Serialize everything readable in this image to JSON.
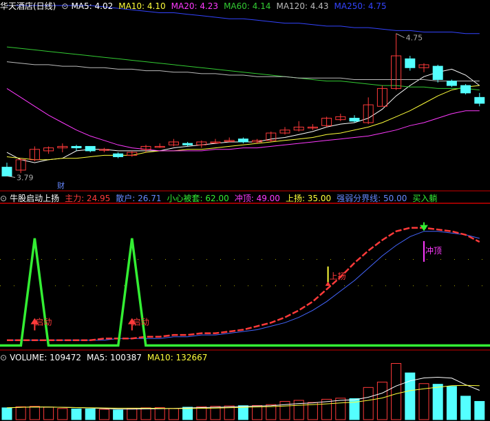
{
  "colors": {
    "bg": "#000000",
    "up": "#ff3a3a",
    "down": "#54ffff",
    "white": "#ffffff",
    "yellow": "#ffff3a",
    "magenta": "#ff3aff",
    "green": "#33cc33",
    "blue": "#2222cc",
    "gray": "#aaaaaa",
    "separator": "#cc0000",
    "orange": "#ff8800"
  },
  "price_panel": {
    "stock_name": "华天酒店(日线)",
    "indicators": [
      {
        "label": "MA5: 4.02",
        "color": "#ffffff"
      },
      {
        "label": "MA10: 4.10",
        "color": "#ffff3a"
      },
      {
        "label": "MA20: 4.23",
        "color": "#ff3aff"
      },
      {
        "label": "MA60: 4.14",
        "color": "#33cc33"
      },
      {
        "label": "MA120: 4.43",
        "color": "#bbbbbb"
      },
      {
        "label": "MA250: 4.75",
        "color": "#3344ff"
      }
    ],
    "high_label": "4.75",
    "low_label": "3.79",
    "caitag": "财"
  },
  "indicator_panel": {
    "title": "牛股启动上扬",
    "items": [
      {
        "label": "主力: 24.95",
        "color": "#ff3a3a"
      },
      {
        "label": "散户: 26.71",
        "color": "#6688ff"
      },
      {
        "label": "小心被套: 62.00",
        "color": "#33ee33"
      },
      {
        "label": "冲顶: 49.00",
        "color": "#ff3aff"
      },
      {
        "label": "上扬: 35.00",
        "color": "#ffff3a"
      },
      {
        "label": "强弱分界线: 50.00",
        "color": "#6688ff"
      },
      {
        "label": "买入躺",
        "color": "#33ee33"
      }
    ],
    "marks": {
      "start": "启动",
      "rise": "上扬",
      "top": "冲顶"
    }
  },
  "volume_panel": {
    "title": "VOLUME: 109472",
    "ma5": "MA5: 100387",
    "ma10": "MA10: 132667"
  },
  "chart_data": {
    "type": "candlestick",
    "candles": [
      {
        "o": 3.85,
        "c": 3.79,
        "h": 3.88,
        "l": 3.79
      },
      {
        "o": 3.83,
        "c": 3.9,
        "h": 3.91,
        "l": 3.81
      },
      {
        "o": 3.9,
        "c": 3.97,
        "h": 3.99,
        "l": 3.89
      },
      {
        "o": 3.96,
        "c": 3.98,
        "h": 3.99,
        "l": 3.94
      },
      {
        "o": 3.98,
        "c": 3.99,
        "h": 4.01,
        "l": 3.95
      },
      {
        "o": 3.99,
        "c": 3.98,
        "h": 4.0,
        "l": 3.96
      },
      {
        "o": 3.99,
        "c": 3.96,
        "h": 3.99,
        "l": 3.95
      },
      {
        "o": 3.97,
        "c": 3.97,
        "h": 3.98,
        "l": 3.95
      },
      {
        "o": 3.94,
        "c": 3.92,
        "h": 3.95,
        "l": 3.91
      },
      {
        "o": 3.93,
        "c": 3.95,
        "h": 3.96,
        "l": 3.92
      },
      {
        "o": 3.97,
        "c": 3.99,
        "h": 4.0,
        "l": 3.95
      },
      {
        "o": 3.99,
        "c": 3.99,
        "h": 4.01,
        "l": 3.98
      },
      {
        "o": 4.0,
        "c": 4.02,
        "h": 4.04,
        "l": 3.99
      },
      {
        "o": 4.01,
        "c": 4.0,
        "h": 4.02,
        "l": 3.99
      },
      {
        "o": 4.0,
        "c": 4.02,
        "h": 4.03,
        "l": 3.98
      },
      {
        "o": 4.02,
        "c": 4.02,
        "h": 4.04,
        "l": 4.01
      },
      {
        "o": 4.03,
        "c": 4.03,
        "h": 4.05,
        "l": 4.02
      },
      {
        "o": 4.04,
        "c": 4.02,
        "h": 4.05,
        "l": 4.01
      },
      {
        "o": 4.02,
        "c": 4.03,
        "h": 4.04,
        "l": 4.01
      },
      {
        "o": 4.03,
        "c": 4.08,
        "h": 4.09,
        "l": 4.02
      },
      {
        "o": 4.08,
        "c": 4.1,
        "h": 4.12,
        "l": 4.07
      },
      {
        "o": 4.1,
        "c": 4.12,
        "h": 4.16,
        "l": 4.09
      },
      {
        "o": 4.12,
        "c": 4.12,
        "h": 4.14,
        "l": 4.1
      },
      {
        "o": 4.13,
        "c": 4.18,
        "h": 4.19,
        "l": 4.12
      },
      {
        "o": 4.17,
        "c": 4.19,
        "h": 4.21,
        "l": 4.16
      },
      {
        "o": 4.18,
        "c": 4.16,
        "h": 4.2,
        "l": 4.15
      },
      {
        "o": 4.15,
        "c": 4.27,
        "h": 4.32,
        "l": 4.14
      },
      {
        "o": 4.26,
        "c": 4.38,
        "h": 4.4,
        "l": 4.26
      },
      {
        "o": 4.38,
        "c": 4.6,
        "h": 4.75,
        "l": 4.37
      },
      {
        "o": 4.58,
        "c": 4.52,
        "h": 4.6,
        "l": 4.5
      },
      {
        "o": 4.52,
        "c": 4.54,
        "h": 4.55,
        "l": 4.49
      },
      {
        "o": 4.53,
        "c": 4.44,
        "h": 4.54,
        "l": 4.42
      },
      {
        "o": 4.43,
        "c": 4.4,
        "h": 4.44,
        "l": 4.39
      },
      {
        "o": 4.4,
        "c": 4.35,
        "h": 4.41,
        "l": 4.34
      },
      {
        "o": 4.32,
        "c": 4.28,
        "h": 4.35,
        "l": 4.26
      }
    ],
    "volumes": [
      55000,
      60000,
      62000,
      58000,
      52000,
      50000,
      50000,
      48000,
      45000,
      52000,
      55000,
      56000,
      52000,
      58000,
      60000,
      62000,
      64000,
      65000,
      66000,
      70000,
      85000,
      90000,
      80000,
      95000,
      100000,
      98000,
      150000,
      175000,
      262000,
      218000,
      168000,
      165000,
      155000,
      109472,
      85000
    ],
    "ma_lines": {
      "MA5": {
        "color": "#ffffff",
        "values": [
          3.95,
          3.9,
          3.88,
          3.9,
          3.91,
          3.96,
          3.97,
          3.97,
          3.96,
          3.96,
          3.96,
          3.96,
          3.98,
          3.99,
          4.0,
          4.01,
          4.02,
          4.02,
          4.02,
          4.04,
          4.05,
          4.07,
          4.09,
          4.12,
          4.14,
          4.15,
          4.18,
          4.24,
          4.33,
          4.4,
          4.46,
          4.49,
          4.51,
          4.47,
          4.4
        ]
      },
      "MA10": {
        "color": "#ffff3a",
        "values": [
          3.92,
          3.91,
          3.9,
          3.9,
          3.91,
          3.91,
          3.92,
          3.93,
          3.93,
          3.93,
          3.95,
          3.96,
          3.96,
          3.97,
          3.97,
          3.98,
          3.99,
          4.0,
          4.01,
          4.02,
          4.03,
          4.04,
          4.05,
          4.07,
          4.08,
          4.1,
          4.12,
          4.15,
          4.19,
          4.23,
          4.28,
          4.33,
          4.37,
          4.39,
          4.4
        ]
      },
      "MA20": {
        "color": "#ff3aff",
        "values": [
          4.38,
          4.32,
          4.26,
          4.2,
          4.15,
          4.1,
          4.06,
          4.03,
          4.0,
          3.98,
          3.97,
          3.96,
          3.96,
          3.96,
          3.96,
          3.97,
          3.97,
          3.98,
          3.98,
          3.99,
          4.0,
          4.01,
          4.02,
          4.03,
          4.04,
          4.05,
          4.06,
          4.08,
          4.1,
          4.13,
          4.15,
          4.18,
          4.21,
          4.23,
          4.23
        ]
      },
      "MA60": {
        "color": "#33cc33",
        "values": [
          4.66,
          4.65,
          4.64,
          4.63,
          4.62,
          4.61,
          4.6,
          4.59,
          4.58,
          4.57,
          4.56,
          4.55,
          4.54,
          4.53,
          4.52,
          4.51,
          4.5,
          4.49,
          4.48,
          4.47,
          4.46,
          4.45,
          4.44,
          4.43,
          4.43,
          4.42,
          4.41,
          4.4,
          4.4,
          4.39,
          4.39,
          4.38,
          4.38,
          4.38,
          4.37
        ]
      },
      "MA120": {
        "color": "#bbbbbb",
        "values": [
          4.56,
          4.55,
          4.54,
          4.54,
          4.53,
          4.53,
          4.52,
          4.52,
          4.51,
          4.51,
          4.5,
          4.5,
          4.49,
          4.49,
          4.48,
          4.48,
          4.47,
          4.47,
          4.46,
          4.46,
          4.46,
          4.45,
          4.45,
          4.45,
          4.45,
          4.44,
          4.44,
          4.44,
          4.44,
          4.44,
          4.44,
          4.43,
          4.43,
          4.43,
          4.43
        ]
      },
      "MA250": {
        "color": "#3344ff",
        "values": [
          5.0,
          4.99,
          4.98,
          4.97,
          4.96,
          4.95,
          4.94,
          4.93,
          4.92,
          4.91,
          4.9,
          4.89,
          4.89,
          4.88,
          4.87,
          4.86,
          4.85,
          4.85,
          4.84,
          4.83,
          4.82,
          4.82,
          4.81,
          4.8,
          4.8,
          4.79,
          4.79,
          4.78,
          4.77,
          4.77,
          4.76,
          4.76,
          4.76,
          4.75,
          4.75
        ]
      }
    },
    "main_force": [
      4,
      4,
      4,
      4,
      4,
      4,
      4,
      5,
      5,
      5,
      6,
      6,
      7,
      7,
      8,
      8,
      9,
      10,
      12,
      14,
      17,
      21,
      26,
      33,
      40,
      48,
      55,
      61,
      66,
      68,
      68,
      67,
      66,
      64,
      60
    ],
    "retail": [
      4,
      4,
      4,
      4,
      4,
      4,
      4,
      4,
      5,
      5,
      5,
      5,
      6,
      6,
      7,
      7,
      8,
      9,
      10,
      12,
      14,
      17,
      21,
      26,
      32,
      38,
      45,
      52,
      58,
      63,
      66,
      66,
      65,
      64,
      62
    ],
    "green_signal": [
      1,
      1,
      1,
      1,
      1,
      1,
      1,
      1,
      1,
      1,
      1,
      1,
      1,
      1,
      1,
      1,
      1,
      1,
      1,
      1,
      1,
      1,
      1,
      1,
      1,
      1,
      1,
      1,
      1,
      1,
      1,
      1,
      1,
      1,
      1
    ],
    "green_spikes": [
      2,
      9
    ],
    "rise_at": 23,
    "top_at": 30
  }
}
